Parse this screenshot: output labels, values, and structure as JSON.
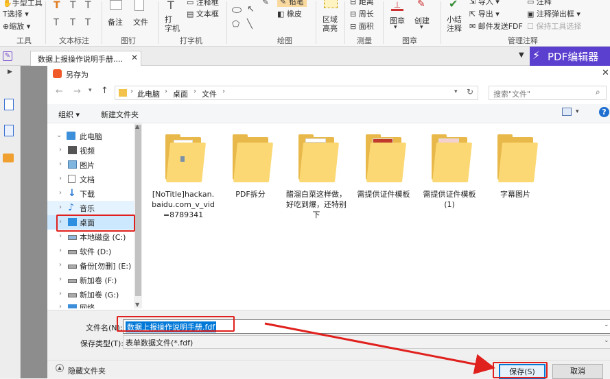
{
  "ribbon": {
    "hand_tool": "手型工具",
    "select": "选择",
    "zoom": "缩放",
    "tools_group": "工具",
    "text_annot_group": "文本标注",
    "note": "备注",
    "file": "文件",
    "pin_group": "图钉",
    "typewriter": "打\n字机",
    "textbox": "文本框",
    "callout": "注释框",
    "typewriter_group": "打字机",
    "pencil": "铅笔",
    "eraser": "橡皮",
    "drawing_group": "绘图",
    "area_highlight": "区域\n高亮",
    "distance": "距离",
    "perimeter": "周长",
    "area": "面积",
    "measure_group": "测量",
    "stamp": "图章",
    "create": "创建",
    "stamp_group": "图章",
    "summary": "小结\n注释",
    "import": "导入",
    "export": "导出",
    "email_fdf": "邮件发送FDF",
    "comment": "注释",
    "comment_popup": "注释弹出框",
    "keep_tool": "保持工具选择",
    "manage_group": "管理注释"
  },
  "tabs": {
    "doc_tab": "数据上报操作说明手册....",
    "pdf_editor": "PDF编辑器"
  },
  "dialog": {
    "title": "另存为",
    "breadcrumb": [
      "此电脑",
      "桌面",
      "文件"
    ],
    "search_placeholder": "搜索\"文件\"",
    "organize": "组织",
    "new_folder": "新建文件夹",
    "help": "?",
    "nav": [
      {
        "label": "此电脑",
        "icon": "computer-icon"
      },
      {
        "label": "视频",
        "icon": "video-icon"
      },
      {
        "label": "图片",
        "icon": "pictures-icon"
      },
      {
        "label": "文档",
        "icon": "documents-icon"
      },
      {
        "label": "下载",
        "icon": "download-icon"
      },
      {
        "label": "音乐",
        "icon": "music-icon"
      },
      {
        "label": "桌面",
        "icon": "desktop-icon"
      },
      {
        "label": "本地磁盘 (C:)",
        "icon": "drive-c-icon"
      },
      {
        "label": "软件 (D:)",
        "icon": "drive-icon"
      },
      {
        "label": "备份[勿删] (E:)",
        "icon": "drive-icon"
      },
      {
        "label": "新加卷 (F:)",
        "icon": "drive-icon"
      },
      {
        "label": "新加卷 (G:)",
        "icon": "drive-icon"
      },
      {
        "label": "网络",
        "icon": "network-icon"
      }
    ],
    "folders": [
      {
        "label": "[NoTitle]hackan.baidu.com_v_vid=8789341"
      },
      {
        "label": "PDF拆分"
      },
      {
        "label": "醋溜白菜这样做，好吃到爆，还特别下"
      },
      {
        "label": "需提供证件模板"
      },
      {
        "label": "需提供证件模板(1)"
      },
      {
        "label": "字幕图片"
      }
    ],
    "filename_label": "文件名(N):",
    "filename_value": "数据上报操作说明手册.fdf",
    "filetype_label": "保存类型(T):",
    "filetype_value": "表单数据文件(*.fdf)",
    "hide_folders": "隐藏文件夹",
    "save_button": "保存(S)",
    "cancel_button": "取消"
  },
  "colors": {
    "accent": "#0078d7",
    "highlight_red": "#e0201c",
    "brand_purple": "#5b3fcf",
    "folder": "#fbd873"
  }
}
